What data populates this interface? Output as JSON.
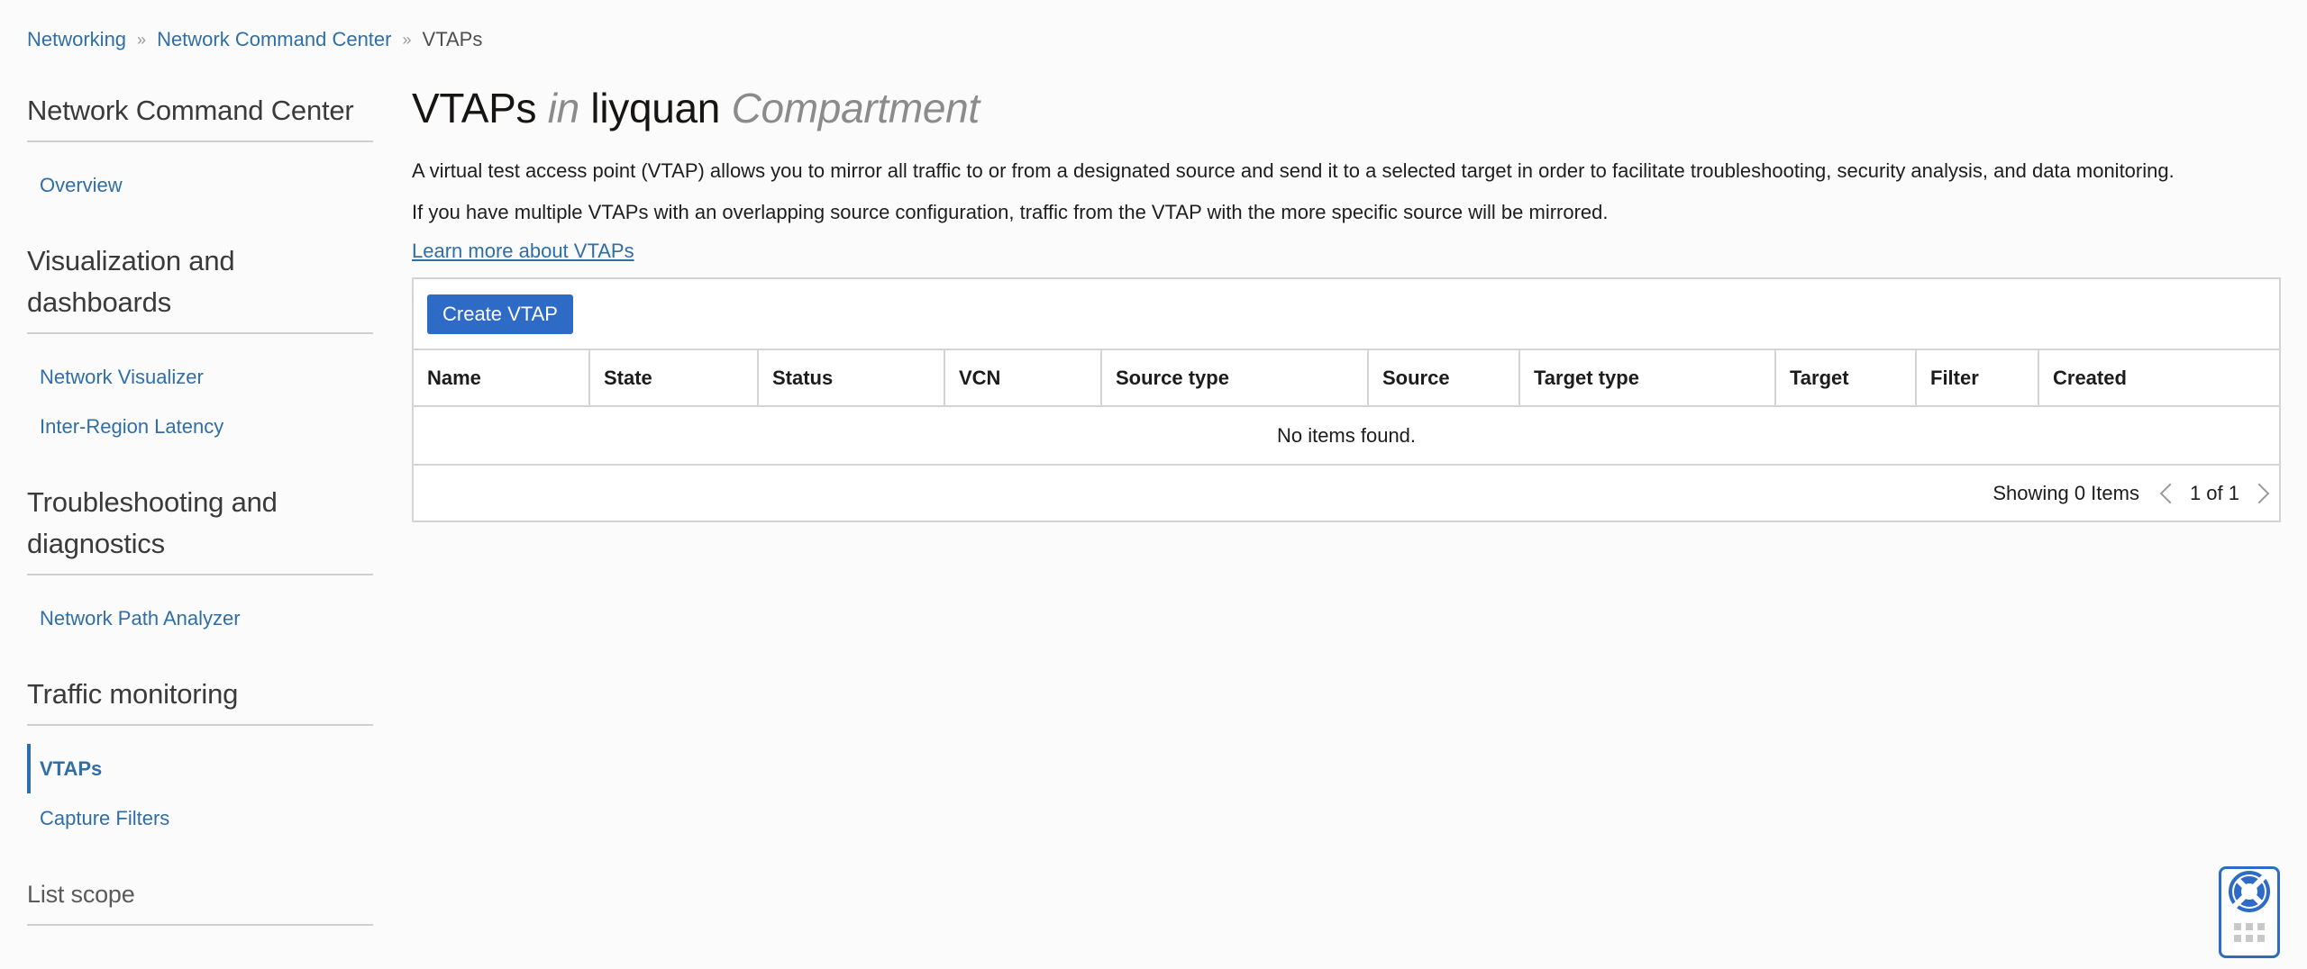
{
  "breadcrumb": {
    "items": [
      "Networking",
      "Network Command Center"
    ],
    "current": "VTAPs"
  },
  "sidebar": {
    "sections": [
      {
        "title": "Network Command Center",
        "items": [
          "Overview"
        ]
      },
      {
        "title": "Visualization and dashboards",
        "items": [
          "Network Visualizer",
          "Inter-Region Latency"
        ]
      },
      {
        "title": "Troubleshooting and diagnostics",
        "items": [
          "Network Path Analyzer"
        ]
      },
      {
        "title": "Traffic monitoring",
        "items": [
          "VTAPs",
          "Capture Filters"
        ],
        "active": "VTAPs"
      },
      {
        "title": "List scope",
        "items": []
      }
    ]
  },
  "main": {
    "title_primary": "VTAPs",
    "title_in": "in",
    "title_compartment_name": "liyquan",
    "title_compartment": "Compartment",
    "description_1": "A virtual test access point (VTAP) allows you to mirror all traffic to or from a designated source and send it to a selected target in order to facilitate troubleshooting, security analysis, and data monitoring.",
    "description_2": "If you have multiple VTAPs with an overlapping source configuration, traffic from the VTAP with the more specific source will be mirrored.",
    "learn_more": "Learn more about VTAPs",
    "create_button": "Create VTAP",
    "table": {
      "columns": [
        "Name",
        "State",
        "Status",
        "VCN",
        "Source type",
        "Source",
        "Target type",
        "Target",
        "Filter",
        "Created"
      ],
      "empty_message": "No items found."
    },
    "footer": {
      "showing": "Showing 0 Items",
      "page": "1 of 1"
    }
  },
  "colors": {
    "link": "#2f6ea6",
    "primary_button": "#2e6bc6",
    "border": "#d4d4d4"
  }
}
